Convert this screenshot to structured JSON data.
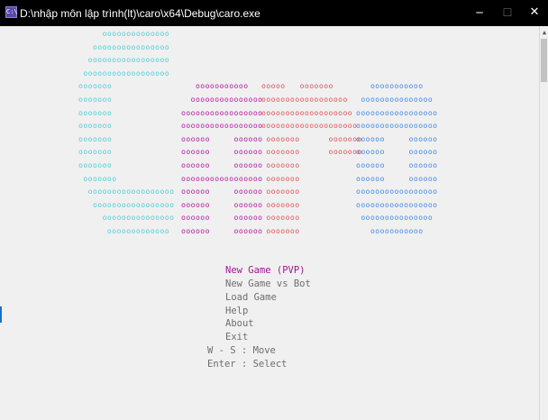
{
  "window": {
    "title": "D:\\nhập môn lập trình(lt)\\caro\\x64\\Debug\\caro.exe",
    "app_icon": "C:\\",
    "minimize_icon": "─",
    "maximize_icon": "☐",
    "close_icon": "✕"
  },
  "colors": {
    "c": "#4ecfd6",
    "a": "#b3179f",
    "r": "#e0525a",
    "o": "#3f8ae8",
    "selected": "#a3159a",
    "normal": "#6e6e6e"
  },
  "logo": {
    "C": [
      "     oooooooooooooo",
      "   oooooooooooooooo",
      "  ooooooooooooooooo",
      " oooooooooooooooooo",
      "ooooooo",
      "ooooooo",
      "ooooooo",
      "ooooooo",
      "ooooooo",
      "ooooooo",
      "ooooooo",
      " ooooooo",
      "  oooooooooooooooooo",
      "   ooooooooooooooooo",
      "     ooooooooooooooo",
      "      ooooooooooooo"
    ],
    "A": [
      "",
      "",
      "",
      "",
      "   ooooooooooo",
      "  ooooooooooooooo",
      "ooooooooooooooooo",
      "ooooooooooooooooo",
      "oooooo     oooooo",
      "oooooo     oooooo",
      "oooooo     oooooo",
      "ooooooooooooooooo",
      "oooooo     oooooo",
      "oooooo     oooooo",
      "oooooo     oooooo",
      "oooooo     oooooo"
    ],
    "R": [
      "",
      "",
      "",
      "",
      "ooooo   ooooooo",
      "oooooooooooooooooo",
      "ooooooooooooooooooo",
      "oooooooooooooooooooo",
      " ooooooo      ooooooo",
      " ooooooo      ooooooo",
      " ooooooo",
      " ooooooo",
      " ooooooo",
      " ooooooo",
      " ooooooo",
      " ooooooo"
    ],
    "O": [
      "",
      "",
      "",
      "",
      "   ooooooooooo",
      " ooooooooooooooo",
      "ooooooooooooooooo",
      "ooooooooooooooooo",
      "oooooo     oooooo",
      "oooooo     oooooo",
      "oooooo     oooooo",
      "oooooo     oooooo",
      "ooooooooooooooooo",
      "ooooooooooooooooo",
      " ooooooooooooooo",
      "   ooooooooooo"
    ]
  },
  "menu": {
    "items": [
      {
        "label": "New Game (PVP)",
        "selected": true
      },
      {
        "label": "New Game vs Bot",
        "selected": false
      },
      {
        "label": "Load Game",
        "selected": false
      },
      {
        "label": "Help",
        "selected": false
      },
      {
        "label": "About",
        "selected": false
      },
      {
        "label": "Exit",
        "selected": false
      }
    ],
    "hints": [
      "W - S : Move",
      "Enter : Select"
    ]
  }
}
